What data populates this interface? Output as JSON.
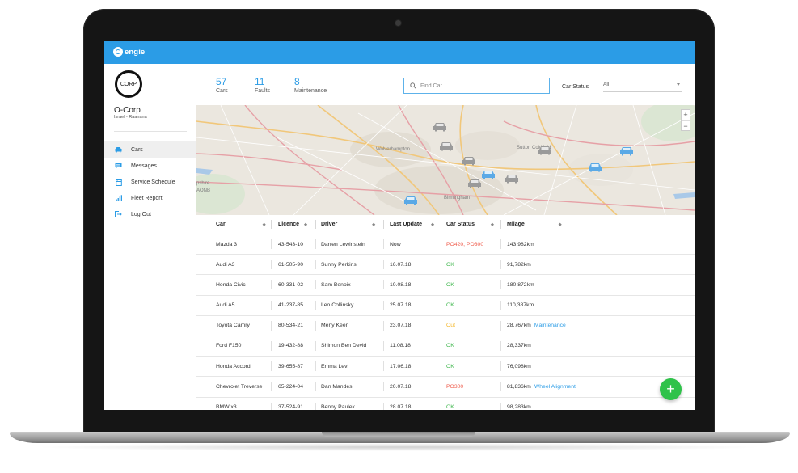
{
  "app": {
    "brand": "engie",
    "accent_color": "#2b9ce6"
  },
  "company": {
    "logo_text": "CORP",
    "name": "O-Corp",
    "location": "Israel - Raanana"
  },
  "sidebar": {
    "items": [
      {
        "label": "Cars",
        "icon": "car-icon",
        "active": true
      },
      {
        "label": "Messages",
        "icon": "message-icon",
        "active": false
      },
      {
        "label": "Service Schedule",
        "icon": "calendar-icon",
        "active": false
      },
      {
        "label": "Fleet Report",
        "icon": "bar-chart-icon",
        "active": false
      },
      {
        "label": "Log Out",
        "icon": "logout-icon",
        "active": false
      }
    ]
  },
  "stats": [
    {
      "value": "57",
      "label": "Cars"
    },
    {
      "value": "11",
      "label": "Faults"
    },
    {
      "value": "8",
      "label": "Maintenance"
    }
  ],
  "search": {
    "placeholder": "Find Car",
    "icon": "search-icon"
  },
  "filter": {
    "label": "Car Status",
    "value": "All"
  },
  "map": {
    "labels": [
      "Wolverhampton",
      "Birmingham",
      "Sutton Coldfield",
      "pshire",
      "AONB"
    ],
    "zoom_in": "+",
    "zoom_out": "−"
  },
  "table": {
    "columns": [
      "Car",
      "Licence",
      "Driver",
      "Last Update",
      "Car Status",
      "Milage"
    ],
    "rows": [
      {
        "car": "Mazda 3",
        "licence": "43-543-10",
        "driver": "Darren Lewinstein",
        "update": "Now",
        "status": "PO420, PO300",
        "status_type": "error",
        "milage": "143,982km",
        "note": ""
      },
      {
        "car": "Audi A3",
        "licence": "61-505-90",
        "driver": "Sunny Perkins",
        "update": "16.07.18",
        "status": "OK",
        "status_type": "ok",
        "milage": "91,782km",
        "note": ""
      },
      {
        "car": "Honda Civic",
        "licence": "60-331-02",
        "driver": "Sam Benoix",
        "update": "10.08.18",
        "status": "OK",
        "status_type": "ok",
        "milage": "180,872km",
        "note": ""
      },
      {
        "car": "Audi A5",
        "licence": "41-237-85",
        "driver": "Leo Collinsky",
        "update": "25.07.18",
        "status": "OK",
        "status_type": "ok",
        "milage": "110,387km",
        "note": ""
      },
      {
        "car": "Toyota Camry",
        "licence": "80-534-21",
        "driver": "Meny Keen",
        "update": "23.07.18",
        "status": "Out",
        "status_type": "warn",
        "milage": "28,767km",
        "note": "Maintenance"
      },
      {
        "car": "Ford F150",
        "licence": "19-432-88",
        "driver": "Shimon Ben Devid",
        "update": "11.08.18",
        "status": "OK",
        "status_type": "ok",
        "milage": "28,337km",
        "note": ""
      },
      {
        "car": "Honda Accord",
        "licence": "39-655-87",
        "driver": "Emma Levi",
        "update": "17.06.18",
        "status": "OK",
        "status_type": "ok",
        "milage": "76,098km",
        "note": ""
      },
      {
        "car": "Chevrolet Treverse",
        "licence": "65-224-04",
        "driver": "Dan Mandes",
        "update": "20.07.18",
        "status": "PO300",
        "status_type": "error",
        "milage": "81,836km",
        "note": "Wheel Alignment"
      },
      {
        "car": "BMW x3",
        "licence": "37-524-91",
        "driver": "Benny Paulek",
        "update": "28.07.18",
        "status": "OK",
        "status_type": "ok",
        "milage": "98,283km",
        "note": ""
      }
    ]
  },
  "fab": {
    "label": "+"
  },
  "colors": {
    "ok": "#3cb54a",
    "error": "#ef5a4a",
    "warn": "#f4b626",
    "fab": "#2fc24a"
  }
}
